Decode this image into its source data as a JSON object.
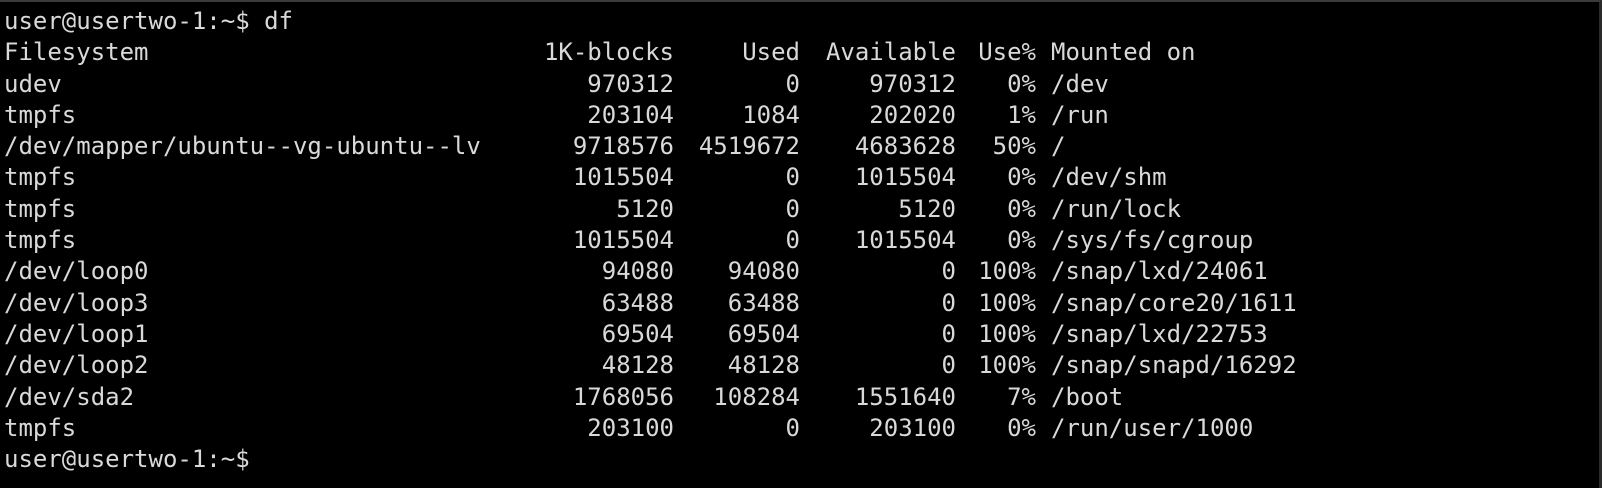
{
  "terminal": {
    "command_prompt": "user@usertwo-1:~$ ",
    "command": "df",
    "final_prompt": "user@usertwo-1:~$ "
  },
  "df": {
    "headers": [
      "Filesystem",
      "1K-blocks",
      "Used",
      "Available",
      "Use%",
      "Mounted on"
    ],
    "rows": [
      [
        "udev",
        "970312",
        "0",
        "970312",
        "0%",
        "/dev"
      ],
      [
        "tmpfs",
        "203104",
        "1084",
        "202020",
        "1%",
        "/run"
      ],
      [
        "/dev/mapper/ubuntu--vg-ubuntu--lv",
        "9718576",
        "4519672",
        "4683628",
        "50%",
        "/"
      ],
      [
        "tmpfs",
        "1015504",
        "0",
        "1015504",
        "0%",
        "/dev/shm"
      ],
      [
        "tmpfs",
        "5120",
        "0",
        "5120",
        "0%",
        "/run/lock"
      ],
      [
        "tmpfs",
        "1015504",
        "0",
        "1015504",
        "0%",
        "/sys/fs/cgroup"
      ],
      [
        "/dev/loop0",
        "94080",
        "94080",
        "0",
        "100%",
        "/snap/lxd/24061"
      ],
      [
        "/dev/loop3",
        "63488",
        "63488",
        "0",
        "100%",
        "/snap/core20/1611"
      ],
      [
        "/dev/loop1",
        "69504",
        "69504",
        "0",
        "100%",
        "/snap/lxd/22753"
      ],
      [
        "/dev/loop2",
        "48128",
        "48128",
        "0",
        "100%",
        "/snap/snapd/16292"
      ],
      [
        "/dev/sda2",
        "1768056",
        "108284",
        "1551640",
        "7%",
        "/boot"
      ],
      [
        "tmpfs",
        "203100",
        "0",
        "203100",
        "0%",
        "/run/user/1000"
      ]
    ]
  },
  "colors": {
    "background": "#000000",
    "foreground": "#d9d9d9"
  }
}
